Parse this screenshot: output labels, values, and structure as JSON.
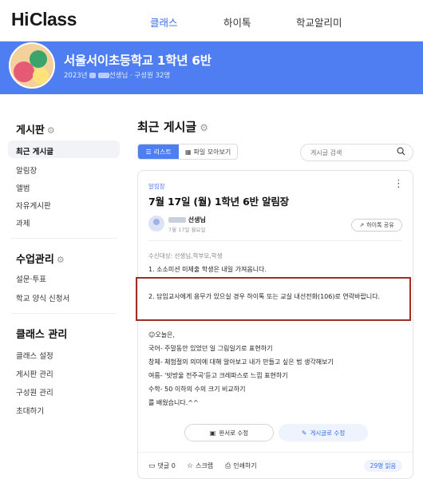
{
  "logo": {
    "hi": "Hi",
    "class_text": "Class"
  },
  "nav": {
    "items": [
      {
        "label": "클래스"
      },
      {
        "label": "하이톡"
      },
      {
        "label": "학교알리미"
      }
    ]
  },
  "banner": {
    "title": "서울서이초등학교 1학년 6반",
    "year": "2023년",
    "sep": "·",
    "teacher_suffix": "선생님",
    "members": "· 구성원 32명"
  },
  "sidebar": {
    "board": {
      "heading": "게시판",
      "items": [
        {
          "label": "최근 게시글"
        },
        {
          "label": "알림장"
        },
        {
          "label": "앨범"
        },
        {
          "label": "자유게시판"
        },
        {
          "label": "과제"
        }
      ]
    },
    "class_mgmt": {
      "heading": "수업관리",
      "items": [
        {
          "label": "설문·투표"
        },
        {
          "label": "학교 양식 신청서"
        }
      ]
    },
    "class_admin": {
      "heading": "클래스 관리",
      "items": [
        {
          "label": "클래스 설정"
        },
        {
          "label": "게시판 관리"
        },
        {
          "label": "구성원 관리"
        },
        {
          "label": "초대하기"
        }
      ]
    },
    "gear_icon": "gear-icon"
  },
  "main": {
    "title": "최근 게시글",
    "tabs": [
      {
        "label": "리스트"
      },
      {
        "label": "파일 모아보기"
      }
    ],
    "search": {
      "placeholder": "게시글 검색"
    }
  },
  "post": {
    "category": "알림장",
    "title": "7월 17일 (월) 1학년 6반 알림장",
    "author": "선생님",
    "date": "7월 17일 월요일",
    "share_label": "하이톡 공유",
    "recipients": "수신대상: 선생님,학부모,학생",
    "notice1": "1. 소소미션 미제출 학생은 내일 가져옵니다.",
    "notice2": "2. 담임교사에게 용무가 있으실 경우 하이톡 또는 교실 내선전화(106)로 연락바랍니다.",
    "body": [
      "☺오늘은,",
      "국어- 주말동안 있었던 일 그림일기로 표현하기",
      "창체- 체험절의 의미에 대해 알아보고 내가 만들고 싶은 법 생각해보기",
      "여름- '빗방울 전주곡'듣고 크레파스로 느낌 표현하기",
      "수학- 50 이하의 수의 크기 비교하기",
      "를 배웠습니다.^^"
    ],
    "buttons": {
      "board_edit": "판서로 수정",
      "post_edit": "게시글로 수정"
    },
    "footer": {
      "comments": "댓글 0",
      "scrap": "스크랩",
      "print": "인쇄하기",
      "reads": "29명 읽음"
    }
  }
}
